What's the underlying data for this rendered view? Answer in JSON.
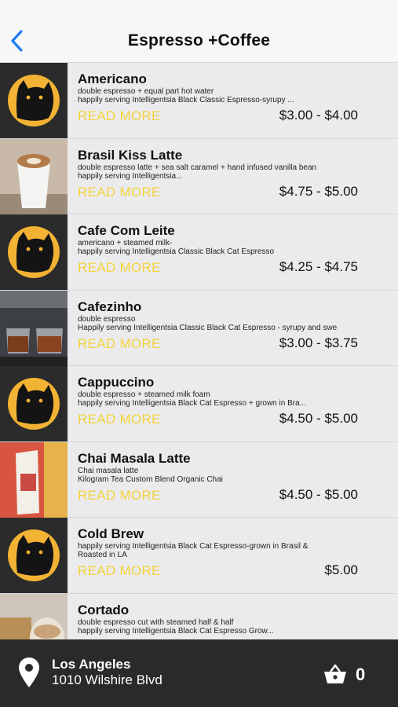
{
  "header": {
    "title": "Espresso +Coffee"
  },
  "items": [
    {
      "name": "Americano",
      "desc1": "double espresso + equal part hot water",
      "desc2": "happily serving Intelligentsia Black Classic Espresso-syrupy ...",
      "more": "READ MORE",
      "price": "$3.00 - $4.00",
      "thumb": "cat-logo"
    },
    {
      "name": "Brasil Kiss Latte",
      "desc1": "double espresso latte + sea salt caramel + hand infused vanilla bean",
      "desc2": "happily serving Intelligentsia...",
      "more": "READ MORE",
      "price": "$4.75 - $5.00",
      "thumb": "latte-cup"
    },
    {
      "name": "Cafe Com Leite",
      "desc1": "americano + steamed milk-",
      "desc2": "happily serving Intelligentsia Classic Black Cat Espresso",
      "more": "READ MORE",
      "price": "$4.25 - $4.75",
      "thumb": "cat-logo"
    },
    {
      "name": "Cafezinho",
      "desc1": "double espresso",
      "desc2": " Happily serving Intelligentsia Classic Black Cat Espresso - syrupy and swe",
      "more": "READ MORE",
      "price": "$3.00 - $3.75",
      "thumb": "espresso-machine"
    },
    {
      "name": "Cappuccino",
      "desc1": "double espresso + steamed milk foam",
      "desc2": "happily serving Intelligentsia Black Cat Espresso + grown in Bra...",
      "more": "READ MORE",
      "price": "$4.50 - $5.00",
      "thumb": "cat-logo"
    },
    {
      "name": "Chai Masala Latte",
      "desc1": "Chai masala latte",
      "desc2": "Kilogram Tea Custom Blend Organic Chai",
      "more": "READ MORE",
      "price": "$4.50 - $5.00",
      "thumb": "chai-box"
    },
    {
      "name": "Cold Brew",
      "desc1": "happily serving Intelligentsia Black Cat Espresso-grown in Brasil &",
      "desc2": "Roasted in LA",
      "more": "READ MORE",
      "price": "$5.00",
      "thumb": "cat-logo"
    },
    {
      "name": "Cortado",
      "desc1": "double espresso cut with steamed half & half",
      "desc2": "happily serving Intelligentsia Black Cat Espresso Grow...",
      "more": "READ MORE",
      "price": "",
      "thumb": "cortado-glass"
    }
  ],
  "footer": {
    "city": "Los Angeles",
    "address": "1010 Wilshire Blvd",
    "cart_count": "0"
  },
  "colors": {
    "accent": "#f3d33a",
    "back": "#1f7cf5",
    "footer_bg": "#2a2a2a",
    "logo_orange": "#f2b233"
  },
  "icons": {
    "back": "chevron-left-icon",
    "location": "map-pin-icon",
    "cart": "basket-icon"
  }
}
